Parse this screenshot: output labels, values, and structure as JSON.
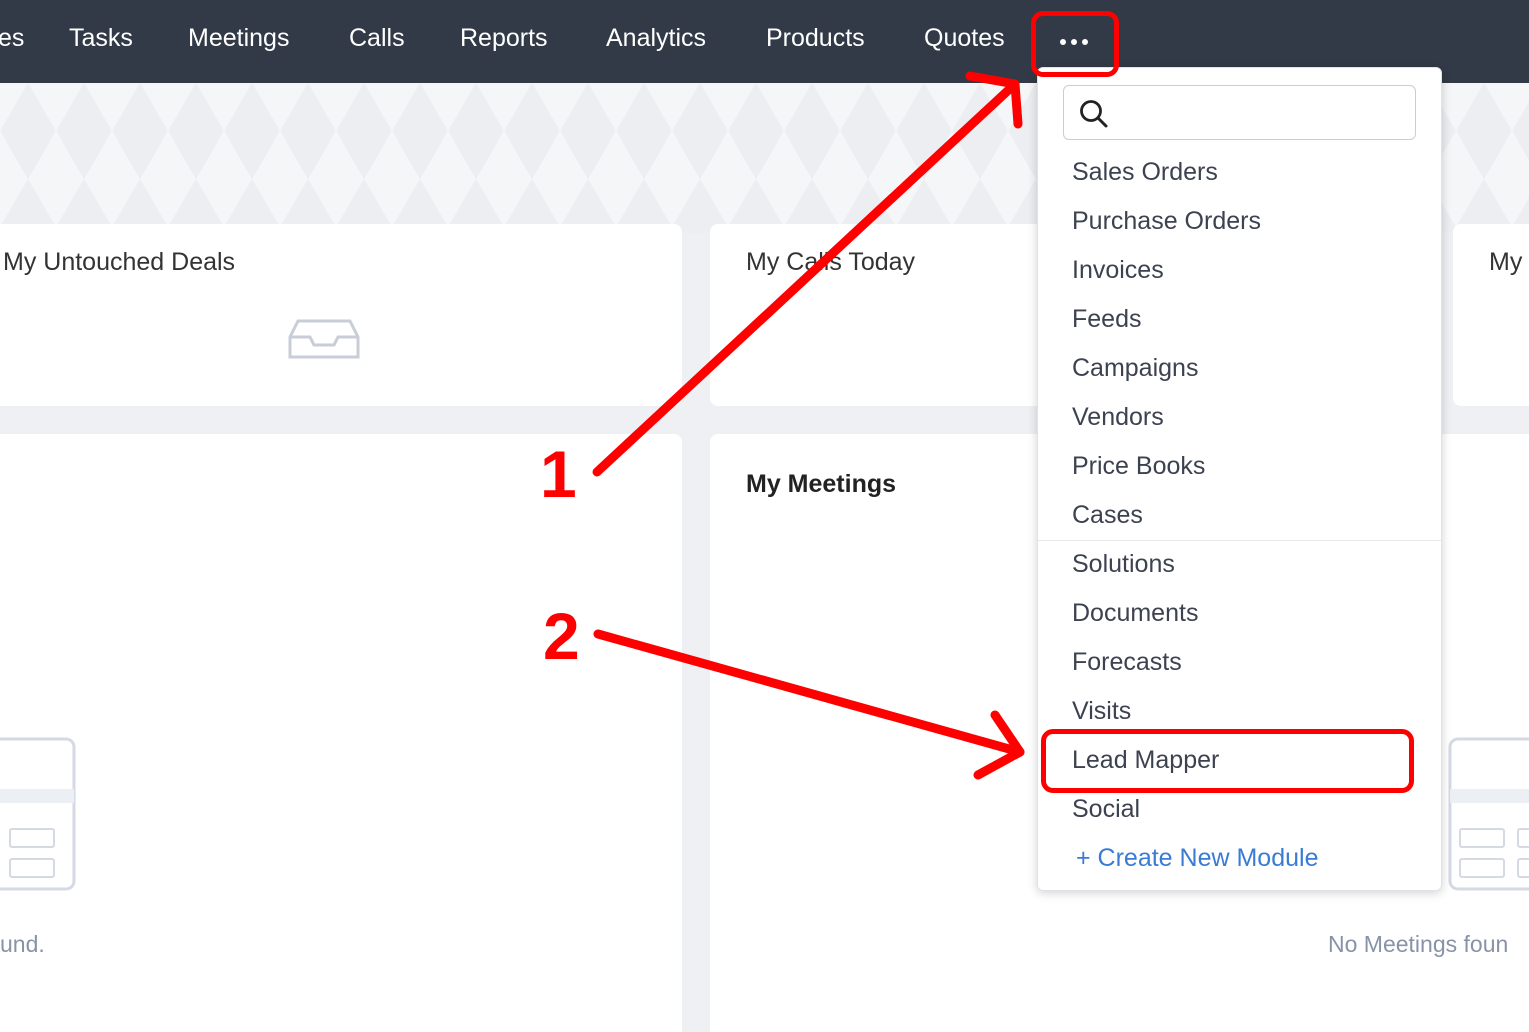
{
  "nav": {
    "partial_left": "es",
    "items": [
      "Tasks",
      "Meetings",
      "Calls",
      "Reports",
      "Analytics",
      "Products",
      "Quotes"
    ],
    "more_icon": "more-horizontal-icon"
  },
  "cards": {
    "untouched_deals": {
      "title": "My Untouched Deals",
      "icon": "inbox-icon"
    },
    "calls_today": {
      "title": "My Calls Today"
    },
    "right_partial": {
      "title": "My"
    },
    "left_lower": {
      "empty_text": "und."
    },
    "meetings": {
      "title": "My Meetings",
      "empty_text": "No Meetings foun"
    }
  },
  "dropdown": {
    "search_placeholder": "",
    "search_icon": "search-icon",
    "items": [
      "Sales Orders",
      "Purchase Orders",
      "Invoices",
      "Feeds",
      "Campaigns",
      "Vendors",
      "Price Books",
      "Cases",
      "Solutions",
      "Documents",
      "Forecasts",
      "Visits",
      "Lead Mapper",
      "Social"
    ],
    "create_label": "+ Create New Module"
  },
  "annotations": {
    "step1": "1",
    "step2": "2",
    "color": "#ff0000"
  },
  "colors": {
    "nav_bg": "#323a47",
    "link_blue": "#3a7bd5"
  }
}
